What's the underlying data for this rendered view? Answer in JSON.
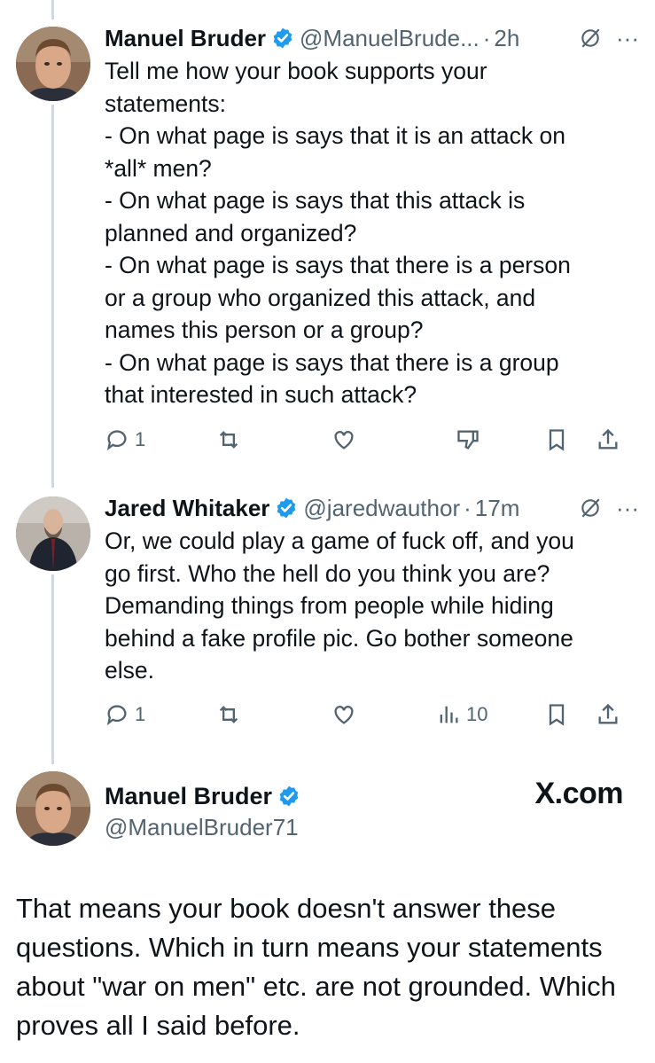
{
  "tweets": [
    {
      "name": "Manuel Bruder",
      "handle": "@ManuelBrude...",
      "dot": "·",
      "time": "2h",
      "text": "Tell me how your book supports your\nstatements:\n- On what page is says that it is an attack on\n*all* men?\n- On what page is says that this attack is\nplanned and organized?\n- On what page is says that there is a person\nor a group who organized this attack, and\nnames this person or a group?\n- On what page is says that there is a group\nthat interested in such attack?",
      "replies": "1"
    },
    {
      "name": "Jared Whitaker",
      "handle": "@jaredwauthor",
      "dot": "·",
      "time": "17m",
      "text": "Or, we could play a game of fuck off, and you\ngo first. Who the hell do you think you are?\nDemanding things from people while hiding\nbehind a fake profile pic. Go bother someone\nelse.",
      "replies": "1",
      "views": "10"
    }
  ],
  "card": {
    "name": "Manuel Bruder",
    "handle": "@ManuelBruder71",
    "site": "X.com",
    "text": "That means your book doesn't answer these questions. Which in turn means your statements about \"war on men\" etc. are not grounded. Which proves all I said before."
  },
  "colors": {
    "verified": "#1d9bf0",
    "secondary": "#536471",
    "thread_line": "#cfd9de"
  },
  "icons": [
    "verified-badge-icon",
    "grok-icon",
    "more-icon",
    "reply-icon",
    "retweet-icon",
    "like-icon",
    "downvote-icon",
    "views-icon",
    "bookmark-icon",
    "share-icon"
  ]
}
